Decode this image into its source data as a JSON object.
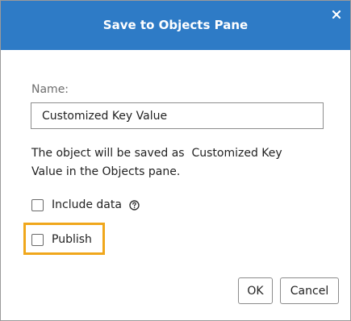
{
  "dialog": {
    "title": "Save to Objects Pane",
    "close_icon": "close-icon"
  },
  "form": {
    "name_label": "Name:",
    "name_value": "Customized Key Value",
    "info_line1": "The object will be saved as  Customized Key",
    "info_line2": "Value in the Objects pane.",
    "include_data_label": "Include data",
    "include_data_checked": false,
    "help_icon": "help-circle-icon",
    "publish_label": "Publish",
    "publish_checked": false
  },
  "buttons": {
    "ok_label": "OK",
    "cancel_label": "Cancel"
  },
  "colors": {
    "titlebar": "#2e7bc6",
    "highlight": "#f0a71c"
  }
}
